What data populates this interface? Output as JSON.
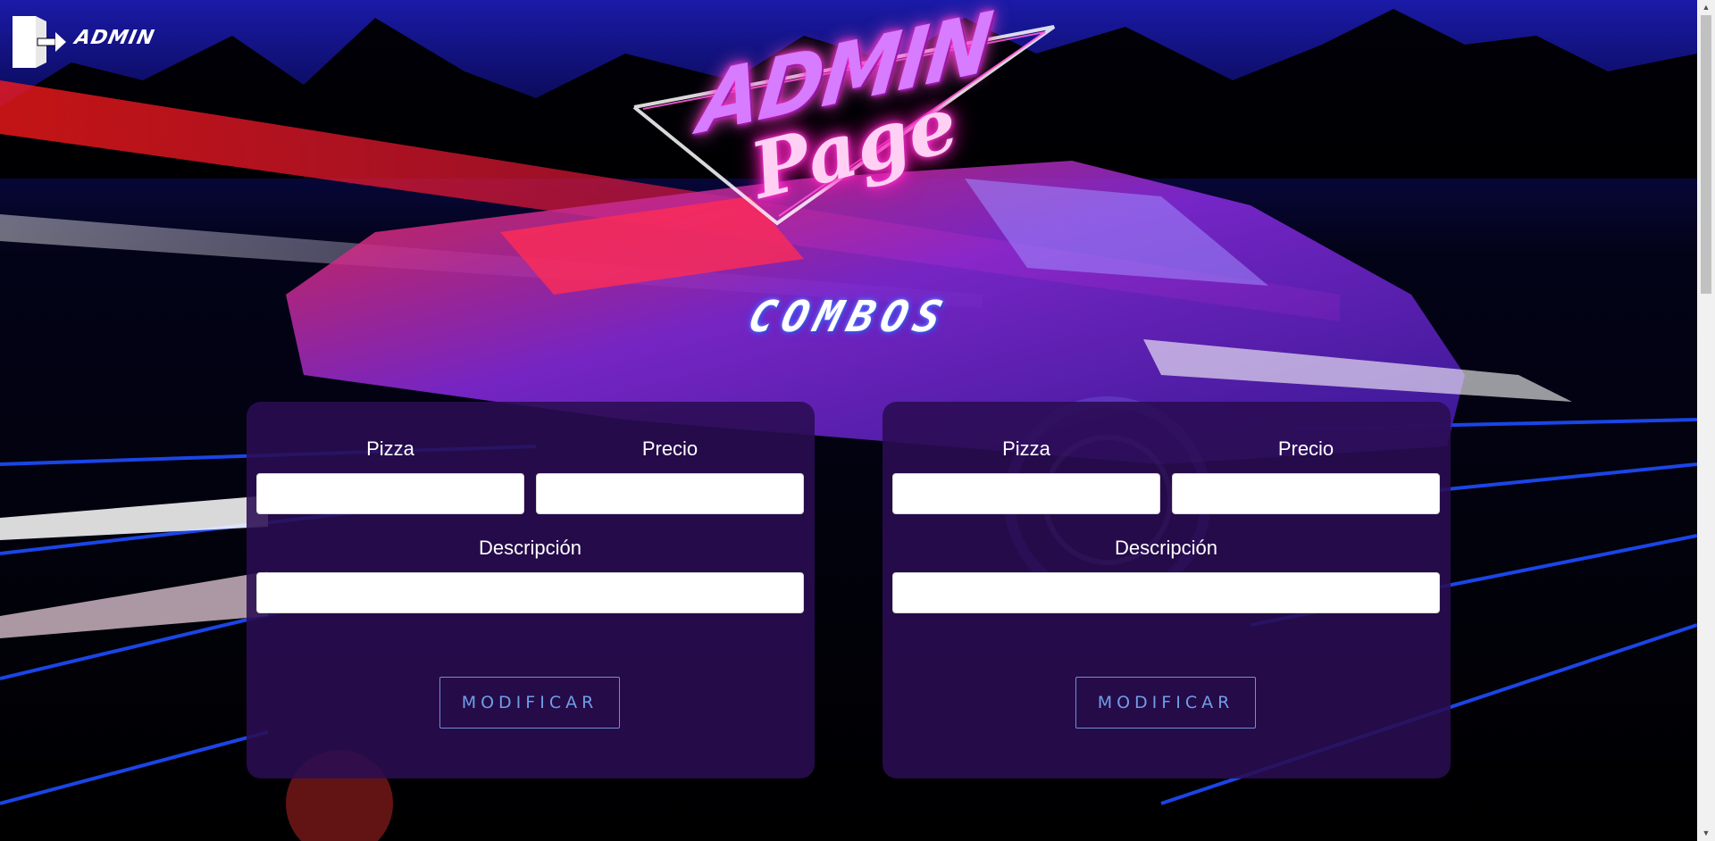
{
  "header": {
    "admin_label": "ADMIN"
  },
  "logo": {
    "line1": "ADMIN",
    "line2": "Page"
  },
  "section_title": "COMBOS",
  "forms": [
    {
      "pizza_label": "Pizza",
      "pizza_value": "",
      "precio_label": "Precio",
      "precio_value": "",
      "descripcion_label": "Descripción",
      "descripcion_value": "",
      "button_label": "MODIFICAR"
    },
    {
      "pizza_label": "Pizza",
      "pizza_value": "",
      "precio_label": "Precio",
      "precio_value": "",
      "descripcion_label": "Descripción",
      "descripcion_value": "",
      "button_label": "MODIFICAR"
    }
  ],
  "colors": {
    "card_bg": "#2a0c52",
    "button_border": "#6f8ed8",
    "button_text": "#6f9ee8",
    "neon_pink": "#ff34d1",
    "neon_blue": "#3a4dff"
  },
  "icons": {
    "logout": "logout-door-icon",
    "scroll_up": "scroll-up-arrow-icon",
    "scroll_down": "scroll-down-arrow-icon"
  }
}
